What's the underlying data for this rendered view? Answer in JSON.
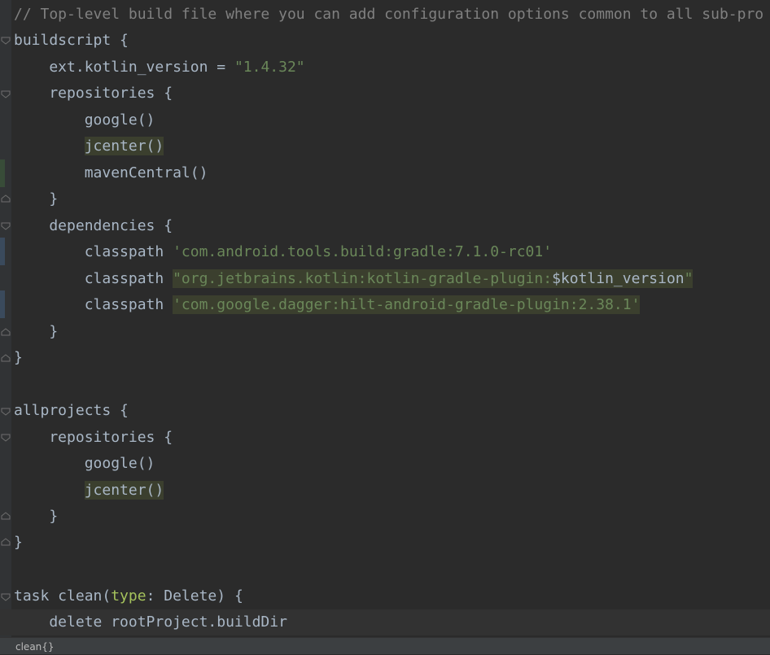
{
  "editor": {
    "lines": [
      "// Top-level build file where you can add configuration options common to all sub-pro",
      "buildscript {",
      "    ext.kotlin_version = ",
      "\"1.4.32\"",
      "    repositories {",
      "        google()",
      "        jcenter()",
      "        mavenCentral()",
      "    }",
      "    dependencies {",
      "        classpath ",
      "'com.android.tools.build:gradle:7.1.0-rc01'",
      "        classpath ",
      "\"org.jetbrains.kotlin:kotlin-gradle-plugin:",
      "$kotlin_version",
      "\"",
      "        classpath ",
      "'com.google.dagger:hilt-android-gradle-plugin:2.38.1'",
      "    }",
      "}",
      "allprojects {",
      "    repositories {",
      "        google()",
      "        jcenter()",
      "    }",
      "}",
      "task clean(",
      "type",
      ": Delete) {",
      "    delete rootProject.buildDir"
    ]
  },
  "statusbar": {
    "breadcrumb": "clean{}"
  }
}
